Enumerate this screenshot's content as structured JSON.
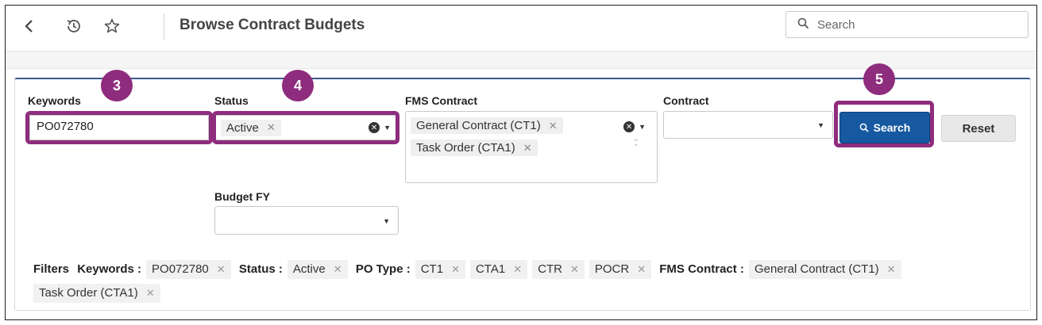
{
  "header": {
    "title": "Browse Contract Budgets",
    "search_placeholder": "Search"
  },
  "form": {
    "keywords": {
      "label": "Keywords",
      "value": "PO072780"
    },
    "status": {
      "label": "Status",
      "chips": [
        "Active"
      ]
    },
    "fms_contract": {
      "label": "FMS Contract",
      "chips": [
        "General Contract (CT1)",
        "Task Order (CTA1)"
      ]
    },
    "contract": {
      "label": "Contract",
      "value": ""
    },
    "budget_fy": {
      "label": "Budget FY",
      "value": ""
    },
    "search_button": "Search",
    "reset_button": "Reset"
  },
  "filters": {
    "label": "Filters",
    "groups": [
      {
        "name": "Keywords :",
        "chips": [
          "PO072780"
        ]
      },
      {
        "name": "Status :",
        "chips": [
          "Active"
        ]
      },
      {
        "name": "PO Type :",
        "chips": [
          "CT1",
          "CTA1",
          "CTR",
          "POCR"
        ]
      },
      {
        "name": "FMS Contract :",
        "chips": [
          "General Contract (CT1)",
          "Task Order (CTA1)"
        ]
      }
    ]
  },
  "annotations": {
    "step_keywords": "3",
    "step_status": "4",
    "step_search": "5",
    "highlight_color": "#8e2c7d"
  },
  "colors": {
    "primary_button": "#1659a0",
    "panel_accent": "#3b5a8c"
  }
}
